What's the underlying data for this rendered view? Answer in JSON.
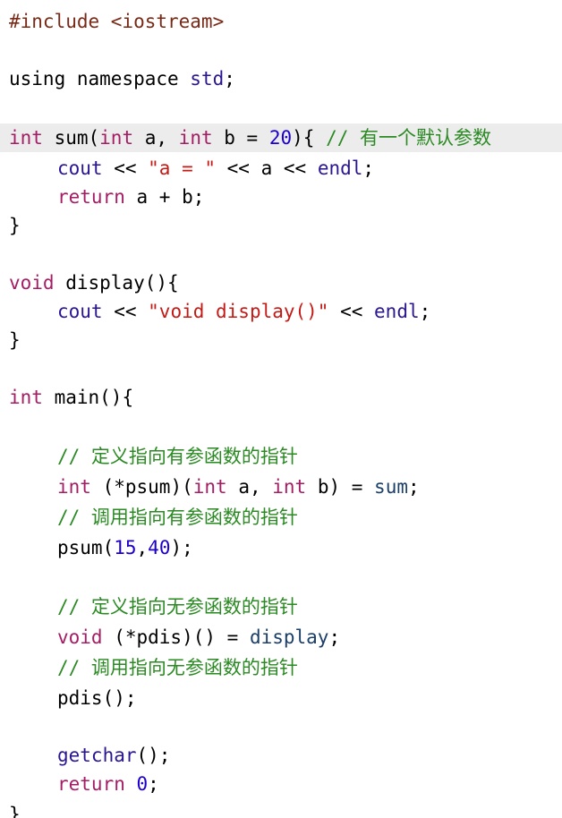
{
  "theme": {
    "background": "#ffffff",
    "current_line_highlight": "#ececec",
    "colors": {
      "plain": "#000000",
      "preproc": "#7a2916",
      "keyword": "#a51d64",
      "builtin": "#2a1693",
      "string": "#c41a16",
      "number": "#1c00cf",
      "comment": "#2b8a23",
      "ident": "#1b3f69"
    }
  },
  "editor": {
    "current_line_index": 4,
    "lines": [
      {
        "indent": 0,
        "tokens": [
          {
            "t": "preproc",
            "v": "#include <iostream>"
          }
        ]
      },
      {
        "indent": 0,
        "tokens": []
      },
      {
        "indent": 0,
        "tokens": [
          {
            "t": "plain",
            "v": "using namespace "
          },
          {
            "t": "builtin",
            "v": "std"
          },
          {
            "t": "plain",
            "v": ";"
          }
        ]
      },
      {
        "indent": 0,
        "tokens": []
      },
      {
        "indent": 0,
        "tokens": [
          {
            "t": "keyword",
            "v": "int"
          },
          {
            "t": "plain",
            "v": " sum("
          },
          {
            "t": "keyword",
            "v": "int"
          },
          {
            "t": "plain",
            "v": " a, "
          },
          {
            "t": "keyword",
            "v": "int"
          },
          {
            "t": "plain",
            "v": " b = "
          },
          {
            "t": "number",
            "v": "20"
          },
          {
            "t": "plain",
            "v": "){ "
          },
          {
            "t": "comment",
            "v": "// 有一个默认参数"
          }
        ]
      },
      {
        "indent": 1,
        "tokens": [
          {
            "t": "builtin",
            "v": "cout"
          },
          {
            "t": "plain",
            "v": " << "
          },
          {
            "t": "string",
            "v": "\"a = \""
          },
          {
            "t": "plain",
            "v": " << a << "
          },
          {
            "t": "builtin",
            "v": "endl"
          },
          {
            "t": "plain",
            "v": ";"
          }
        ]
      },
      {
        "indent": 1,
        "tokens": [
          {
            "t": "keyword",
            "v": "return"
          },
          {
            "t": "plain",
            "v": " a + b;"
          }
        ]
      },
      {
        "indent": 0,
        "tokens": [
          {
            "t": "plain",
            "v": "}"
          }
        ]
      },
      {
        "indent": 0,
        "tokens": []
      },
      {
        "indent": 0,
        "tokens": [
          {
            "t": "keyword",
            "v": "void"
          },
          {
            "t": "plain",
            "v": " display(){"
          }
        ]
      },
      {
        "indent": 1,
        "tokens": [
          {
            "t": "builtin",
            "v": "cout"
          },
          {
            "t": "plain",
            "v": " << "
          },
          {
            "t": "string",
            "v": "\"void display()\""
          },
          {
            "t": "plain",
            "v": " << "
          },
          {
            "t": "builtin",
            "v": "endl"
          },
          {
            "t": "plain",
            "v": ";"
          }
        ]
      },
      {
        "indent": 0,
        "tokens": [
          {
            "t": "plain",
            "v": "}"
          }
        ]
      },
      {
        "indent": 0,
        "tokens": []
      },
      {
        "indent": 0,
        "tokens": [
          {
            "t": "keyword",
            "v": "int"
          },
          {
            "t": "plain",
            "v": " main(){"
          }
        ]
      },
      {
        "indent": 0,
        "tokens": []
      },
      {
        "indent": 1,
        "tokens": [
          {
            "t": "comment",
            "v": "// 定义指向有参函数的指针"
          }
        ]
      },
      {
        "indent": 1,
        "tokens": [
          {
            "t": "keyword",
            "v": "int"
          },
          {
            "t": "plain",
            "v": " (*psum)("
          },
          {
            "t": "keyword",
            "v": "int"
          },
          {
            "t": "plain",
            "v": " a, "
          },
          {
            "t": "keyword",
            "v": "int"
          },
          {
            "t": "plain",
            "v": " b) = "
          },
          {
            "t": "ident",
            "v": "sum"
          },
          {
            "t": "plain",
            "v": ";"
          }
        ]
      },
      {
        "indent": 1,
        "tokens": [
          {
            "t": "comment",
            "v": "// 调用指向有参函数的指针"
          }
        ]
      },
      {
        "indent": 1,
        "tokens": [
          {
            "t": "plain",
            "v": "psum("
          },
          {
            "t": "number",
            "v": "15"
          },
          {
            "t": "plain",
            "v": ","
          },
          {
            "t": "number",
            "v": "40"
          },
          {
            "t": "plain",
            "v": ");"
          }
        ]
      },
      {
        "indent": 0,
        "tokens": []
      },
      {
        "indent": 1,
        "tokens": [
          {
            "t": "comment",
            "v": "// 定义指向无参函数的指针"
          }
        ]
      },
      {
        "indent": 1,
        "tokens": [
          {
            "t": "keyword",
            "v": "void"
          },
          {
            "t": "plain",
            "v": " (*pdis)() = "
          },
          {
            "t": "ident",
            "v": "display"
          },
          {
            "t": "plain",
            "v": ";"
          }
        ]
      },
      {
        "indent": 1,
        "tokens": [
          {
            "t": "comment",
            "v": "// 调用指向无参函数的指针"
          }
        ]
      },
      {
        "indent": 1,
        "tokens": [
          {
            "t": "plain",
            "v": "pdis();"
          }
        ]
      },
      {
        "indent": 0,
        "tokens": []
      },
      {
        "indent": 1,
        "tokens": [
          {
            "t": "builtin",
            "v": "getchar"
          },
          {
            "t": "plain",
            "v": "();"
          }
        ]
      },
      {
        "indent": 1,
        "tokens": [
          {
            "t": "keyword",
            "v": "return"
          },
          {
            "t": "plain",
            "v": " "
          },
          {
            "t": "number",
            "v": "0"
          },
          {
            "t": "plain",
            "v": ";"
          }
        ]
      },
      {
        "indent": 0,
        "tokens": [
          {
            "t": "plain",
            "v": "}"
          }
        ]
      }
    ]
  }
}
